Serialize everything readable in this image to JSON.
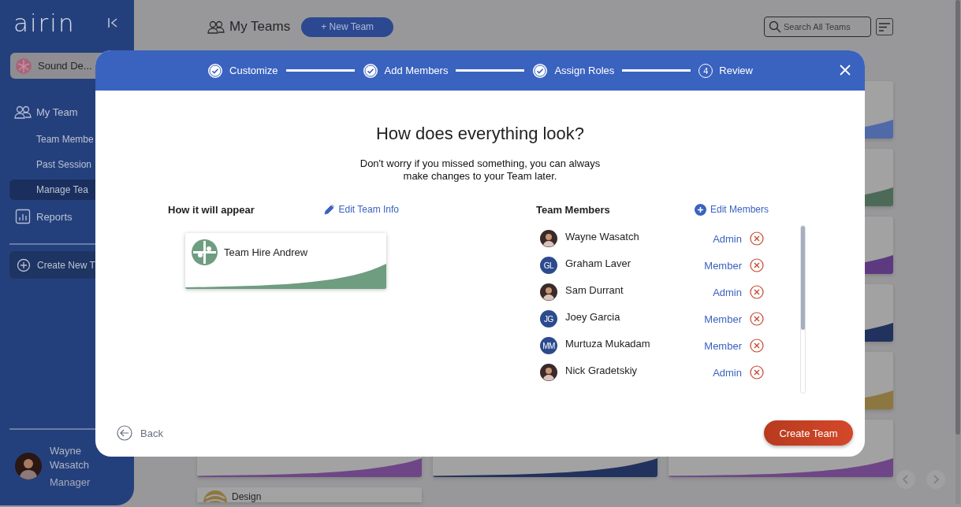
{
  "sidebar": {
    "logo": "airin",
    "team_selector": {
      "label": "Sound De..."
    },
    "nav": [
      {
        "label": "My Team",
        "selected": false,
        "children": [
          {
            "label": "Team Membe",
            "selected": false
          },
          {
            "label": "Past Session",
            "selected": false
          },
          {
            "label": "Manage Tea",
            "selected": true
          }
        ]
      },
      {
        "label": "Reports",
        "selected": false
      }
    ],
    "create_button": "Create New T",
    "user": {
      "name": "Wayne Wasatch",
      "role": "Manager"
    }
  },
  "header": {
    "title": "My Teams",
    "new_team_button": "+ New Team",
    "search": {
      "placeholder": "Search All Teams"
    }
  },
  "team_cards": {
    "edge_cards": [
      {
        "color": "#5069a8"
      },
      {
        "color": "#4d6a58"
      },
      {
        "color": "#5d3a80"
      },
      {
        "color": "#22325e"
      },
      {
        "color": "#8d7740"
      },
      {
        "color": "#6e4687"
      }
    ],
    "bottom_row": [
      {
        "color": "#6e4687"
      },
      {
        "color": "#22325e"
      }
    ],
    "design_card": {
      "name": "Design"
    }
  },
  "modal": {
    "steps": [
      {
        "label": "Customize",
        "done": true
      },
      {
        "label": "Add Members",
        "done": true
      },
      {
        "label": "Assign Roles",
        "done": true
      },
      {
        "label": "Review",
        "done": false,
        "number": "4"
      }
    ],
    "title": "How does everything look?",
    "subtitle": "Don't worry if you missed something, you can always make changes to your Team later.",
    "preview": {
      "heading": "How it will appear",
      "edit_link": "Edit Team Info",
      "card": {
        "name": "Team Hire Andrew",
        "color": "#6f9d80"
      }
    },
    "members": {
      "heading": "Team Members",
      "edit_link": "Edit Members",
      "list": [
        {
          "name": "Wayne Wasatch",
          "role": "Admin",
          "avatar": {
            "kind": "figure"
          }
        },
        {
          "name": "Graham Laver",
          "role": "Member",
          "avatar": {
            "kind": "initials",
            "text": "GL"
          }
        },
        {
          "name": "Sam Durrant",
          "role": "Admin",
          "avatar": {
            "kind": "figure"
          }
        },
        {
          "name": "Joey Garcia",
          "role": "Member",
          "avatar": {
            "kind": "initials",
            "text": "JG"
          }
        },
        {
          "name": "Murtuza Mukadam",
          "role": "Member",
          "avatar": {
            "kind": "initials",
            "text": "MM"
          }
        },
        {
          "name": "Nick Gradetskiy",
          "role": "Admin",
          "avatar": {
            "kind": "figure"
          }
        }
      ]
    },
    "back_button": "Back",
    "primary_button": "Create Team"
  }
}
